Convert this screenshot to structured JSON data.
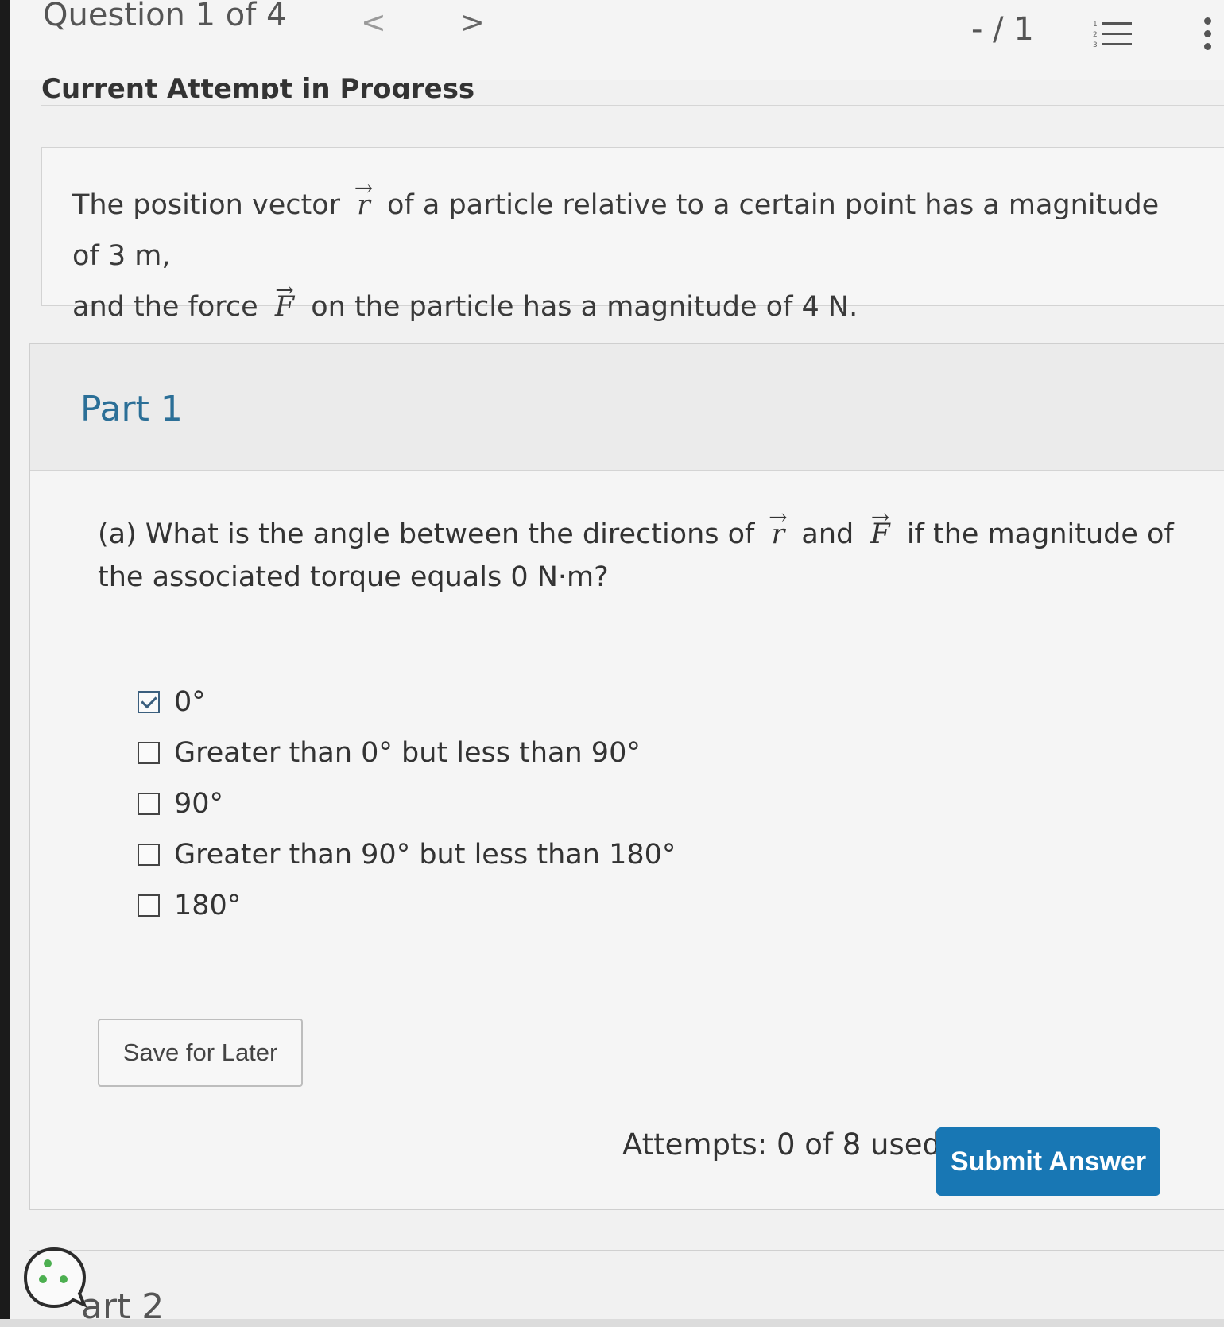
{
  "header": {
    "title": "Question 1 of 4",
    "prev_glyph": "<",
    "next_glyph": ">",
    "score": "- / 1"
  },
  "status": {
    "text": "Current Attempt in Progress"
  },
  "stem": {
    "part1": "The position vector",
    "vec_r": "r",
    "part2": "of a particle relative to a certain point has a magnitude of 3 m,",
    "part3": "and the force",
    "vec_f": "F",
    "part4": "on the particle has a magnitude of 4 N."
  },
  "part": {
    "title": "Part 1",
    "question": {
      "prefix": "(a) What is the angle between the directions of",
      "vec_r": "r",
      "and": "and",
      "vec_f": "F",
      "suffix": "if the magnitude of the associated torque equals 0 N·m?"
    },
    "choices": [
      {
        "label": "0°",
        "checked": true
      },
      {
        "label": "Greater than 0° but less than 90°",
        "checked": false
      },
      {
        "label": "90°",
        "checked": false
      },
      {
        "label": "Greater than 90° but less than 180°",
        "checked": false
      },
      {
        "label": "180°",
        "checked": false
      }
    ],
    "save_label": "Save for Later",
    "attempts": "Attempts: 0 of 8 used",
    "submit_label": "Submit Answer"
  },
  "next_part": {
    "label": "art 2"
  },
  "colors": {
    "accent": "#1877b4",
    "part_title": "#2b6f97"
  },
  "icons": {
    "list": "numbered-list-icon",
    "more": "more-vertical-icon",
    "help": "help-bubble-icon"
  }
}
